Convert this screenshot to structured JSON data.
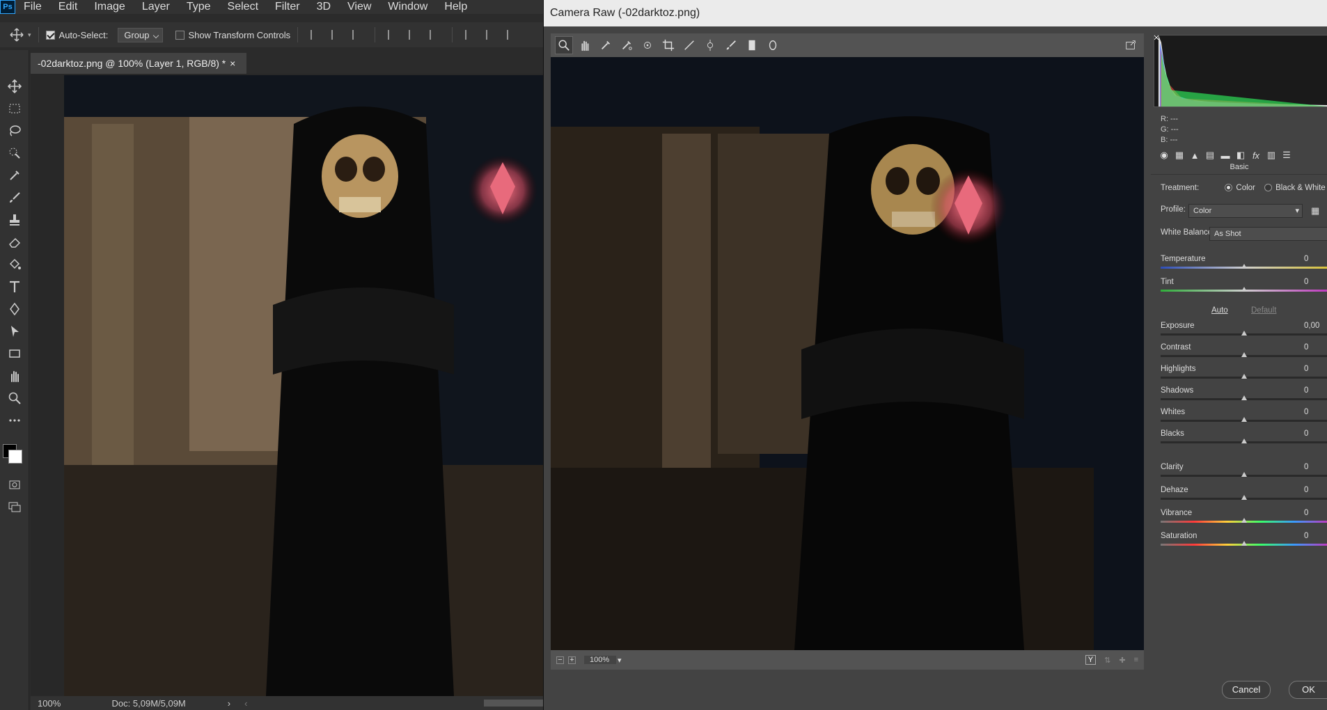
{
  "app": {
    "logo": "Ps",
    "menus": [
      "File",
      "Edit",
      "Image",
      "Layer",
      "Type",
      "Select",
      "Filter",
      "3D",
      "View",
      "Window",
      "Help"
    ]
  },
  "options_bar": {
    "auto_select_label": "Auto-Select:",
    "auto_select_value": "Group",
    "show_transform_label": "Show Transform Controls"
  },
  "document": {
    "tab_title": "-02darktoz.png @ 100% (Layer 1, RGB/8) *",
    "close": "×"
  },
  "status_bar": {
    "zoom": "100%",
    "doc_size": "Doc: 5,09M/5,09M"
  },
  "tools": [
    "move-icon",
    "marquee-icon",
    "lasso-icon",
    "quick-select-icon",
    "eyedropper-icon",
    "brush-icon",
    "stamp-icon",
    "eraser-icon",
    "paint-bucket-icon",
    "type-icon",
    "pen-icon",
    "path-select-icon",
    "rectangle-icon",
    "hand-icon",
    "zoom-icon",
    "more-tools-icon"
  ],
  "camera_raw": {
    "title": "Camera Raw (-02darktoz.png)",
    "readout": {
      "r": "R:   ---",
      "g": "G:   ---",
      "b": "B:   ---"
    },
    "panel_name": "Basic",
    "treatment_label": "Treatment:",
    "treatment_color": "Color",
    "treatment_bw": "Black & White",
    "profile_label": "Profile:",
    "profile_value": "Color",
    "wb_label": "White Balance:",
    "wb_value": "As Shot",
    "auto_label": "Auto",
    "default_label": "Default",
    "sliders": [
      {
        "name": "Temperature",
        "value": "0",
        "position": 0.5
      },
      {
        "name": "Tint",
        "value": "0",
        "position": 0.5
      },
      {
        "name": "Exposure",
        "value": "0,00",
        "position": 0.5
      },
      {
        "name": "Contrast",
        "value": "0",
        "position": 0.5
      },
      {
        "name": "Highlights",
        "value": "0",
        "position": 0.5
      },
      {
        "name": "Shadows",
        "value": "0",
        "position": 0.5
      },
      {
        "name": "Whites",
        "value": "0",
        "position": 0.5
      },
      {
        "name": "Blacks",
        "value": "0",
        "position": 0.5
      },
      {
        "name": "Clarity",
        "value": "0",
        "position": 0.5
      },
      {
        "name": "Dehaze",
        "value": "0",
        "position": 0.5
      },
      {
        "name": "Vibrance",
        "value": "0",
        "position": 0.5
      },
      {
        "name": "Saturation",
        "value": "0",
        "position": 0.5
      }
    ],
    "zoom": "100%",
    "cancel_label": "Cancel",
    "ok_label": "OK"
  }
}
